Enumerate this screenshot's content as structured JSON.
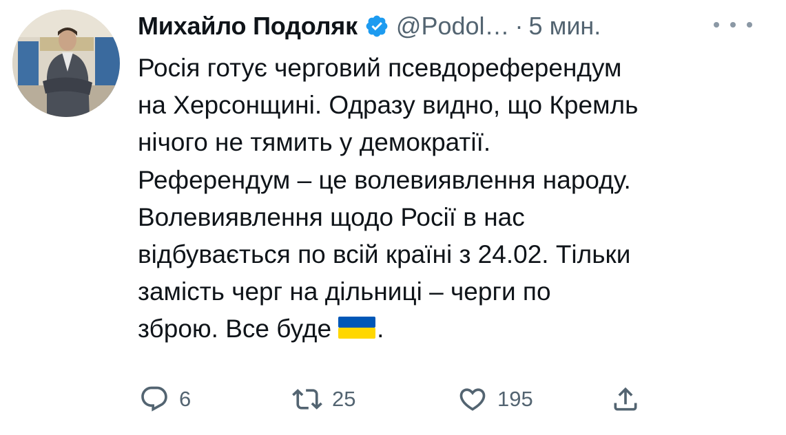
{
  "author": {
    "name": "Михайло Подоляк",
    "handle": "@Podol…",
    "separator": "·",
    "time": "5 мин.",
    "verified": true,
    "avatar_icon": "profile-photo"
  },
  "tweet": {
    "lines": [
      "Росія готує черговий псевдореферендум",
      "на Херсонщині. Одразу видно, що Кремль",
      "нічого не тямить у демократії.",
      "Референдум – це волевиявлення народу.",
      "Волевиявлення щодо Росії в нас",
      "відбувається по всій країні з 24.02. Тільки",
      "замість черг на дільниці – черги по",
      "зброю. Все буде"
    ],
    "trailing_emoji": "ukraine-flag-emoji",
    "trailing_text": "."
  },
  "actions": {
    "reply": {
      "icon": "reply-icon",
      "count": "6"
    },
    "retweet": {
      "icon": "retweet-icon",
      "count": "25"
    },
    "like": {
      "icon": "heart-icon",
      "count": "195"
    },
    "share": {
      "icon": "share-icon"
    }
  },
  "colors": {
    "text": "#0f1419",
    "secondary": "#536471",
    "verified": "#1d9bf0",
    "flag_blue": "#0057b7",
    "flag_yellow": "#ffd700"
  }
}
